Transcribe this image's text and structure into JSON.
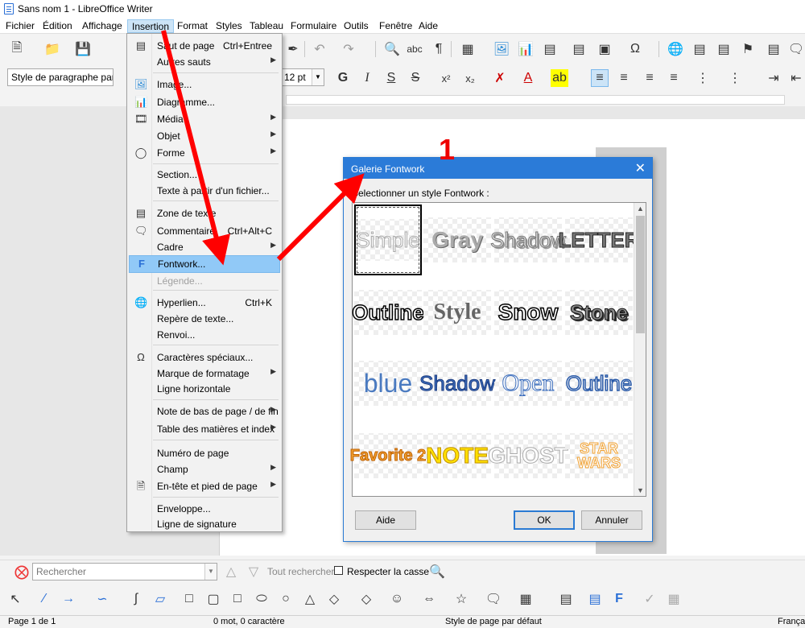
{
  "window": {
    "title": "Sans nom 1 - LibreOffice Writer"
  },
  "menubar": [
    "Fichier",
    "Édition",
    "Affichage",
    "Insertion",
    "Format",
    "Styles",
    "Tableau",
    "Formulaire",
    "Outils",
    "Fenêtre",
    "Aide"
  ],
  "formatbar": {
    "paragraph_style": "Style de paragraphe par",
    "font_size": "12 pt"
  },
  "insert_menu": [
    {
      "label": "Saut de page",
      "shortcut": "Ctrl+Entree",
      "icon": "page-break-icon"
    },
    {
      "label": "Autres sauts",
      "submenu": true
    },
    {
      "sep": true
    },
    {
      "label": "Image...",
      "icon": "image-icon"
    },
    {
      "label": "Diagramme...",
      "icon": "chart-icon"
    },
    {
      "label": "Média",
      "submenu": true,
      "icon": "media-icon"
    },
    {
      "label": "Objet",
      "submenu": true
    },
    {
      "label": "Forme",
      "submenu": true,
      "icon": "shape-icon"
    },
    {
      "sep": true
    },
    {
      "label": "Section..."
    },
    {
      "label": "Texte à partir d'un fichier..."
    },
    {
      "sep": true
    },
    {
      "label": "Zone de texte",
      "icon": "textbox-icon"
    },
    {
      "label": "Commentaire",
      "shortcut": "Ctrl+Alt+C",
      "icon": "comment-icon"
    },
    {
      "label": "Cadre",
      "submenu": true
    },
    {
      "label": "Fontwork...",
      "highlight": true,
      "icon": "fontwork-icon"
    },
    {
      "label": "Légende...",
      "disabled": true
    },
    {
      "sep": true
    },
    {
      "label": "Hyperlien...",
      "shortcut": "Ctrl+K",
      "icon": "hyperlink-icon"
    },
    {
      "label": "Repère de texte..."
    },
    {
      "label": "Renvoi..."
    },
    {
      "sep": true
    },
    {
      "label": "Caractères spéciaux...",
      "icon": "omega-icon"
    },
    {
      "label": "Marque de formatage",
      "submenu": true
    },
    {
      "label": "Ligne horizontale"
    },
    {
      "sep": true
    },
    {
      "label": "Note de bas de page / de fin",
      "submenu": true
    },
    {
      "label": "Table des matières et index",
      "submenu": true
    },
    {
      "sep": true
    },
    {
      "label": "Numéro de page"
    },
    {
      "label": "Champ",
      "submenu": true
    },
    {
      "label": "En-tête et pied de page",
      "submenu": true,
      "icon": "header-footer-icon"
    },
    {
      "sep": true
    },
    {
      "label": "Enveloppe..."
    },
    {
      "label": "Ligne de signature"
    }
  ],
  "dialog": {
    "title": "Galerie Fontwork",
    "lead": "Selectionner un style Fontwork :",
    "styles": [
      "Simple",
      "Gray",
      "Shadow",
      "LETTER",
      "Outline",
      "Style",
      "Snow",
      "Stone",
      "blue",
      "Shadow",
      "Open",
      "Outline",
      "Favorite 2",
      "NOTE",
      "GHOST",
      "STAR WARS"
    ],
    "help": "Aide",
    "ok": "OK",
    "cancel": "Annuler"
  },
  "annotation": "1",
  "findbar": {
    "placeholder": "Rechercher",
    "find_all": "Tout rechercher",
    "match_case": "Respecter la casse"
  },
  "status": {
    "page": "Page 1 de 1",
    "words": "0 mot, 0 caractère",
    "page_style": "Style de page par défaut",
    "language": "Françai"
  },
  "colors": {
    "accent": "#2b7bd8",
    "arrow": "#ff0000",
    "highlight": "#91c9f7"
  }
}
